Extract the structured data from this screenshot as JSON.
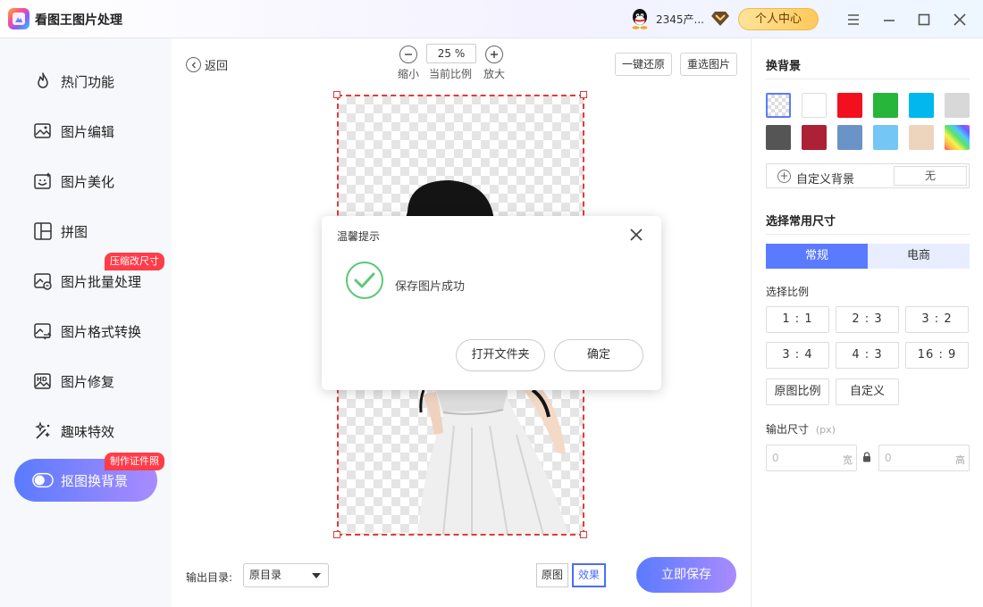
{
  "app": {
    "title": "看图王图片处理",
    "user_name": "2345产...",
    "personal_center": "个人中心"
  },
  "sidebar": {
    "items": [
      {
        "label": "热门功能",
        "icon": "flame-icon"
      },
      {
        "label": "图片编辑",
        "icon": "image-edit-icon"
      },
      {
        "label": "图片美化",
        "icon": "image-beautify-icon"
      },
      {
        "label": "拼图",
        "icon": "collage-icon"
      },
      {
        "label": "图片批量处理",
        "icon": "batch-image-icon",
        "badge": "压缩改尺寸"
      },
      {
        "label": "图片格式转换",
        "icon": "format-convert-icon"
      },
      {
        "label": "图片修复",
        "icon": "hd-image-icon"
      },
      {
        "label": "趣味特效",
        "icon": "magic-wand-icon"
      },
      {
        "label": "抠图换背景",
        "icon": "cutout-toggle-icon",
        "badge": "制作证件照",
        "active": true
      }
    ]
  },
  "toolbar": {
    "back": "返回",
    "zoom_value": "25 %",
    "zoom_out": "缩小",
    "current_ratio": "当前比例",
    "zoom_in": "放大",
    "reset": "一键还原",
    "reselect": "重选图片"
  },
  "footer": {
    "output_dir_label": "输出目录:",
    "output_dir_value": "原目录",
    "view_original": "原图",
    "view_effect": "效果",
    "save_now": "立即保存"
  },
  "right_panel": {
    "bg_title": "换背景",
    "swatch_colors": [
      "transparent",
      "#ffffff",
      "#f2101f",
      "#27b53a",
      "#00b7ee",
      "#d8d8d8",
      "#555555",
      "#ad2136",
      "#6a94c8",
      "#74c6f5",
      "#ecd4bd",
      "rainbow"
    ],
    "custom_bg_label": "自定义背景",
    "custom_bg_value": "无",
    "size_title": "选择常用尺寸",
    "tab_regular": "常规",
    "tab_ecommerce": "电商",
    "ratio_label": "选择比例",
    "ratios": [
      "1 : 1",
      "2 : 3",
      "3 : 2",
      "3 : 4",
      "4 : 3",
      "16 : 9"
    ],
    "original_ratio": "原图比例",
    "custom_ratio": "自定义",
    "output_size_label": "输出尺寸",
    "output_size_unit": "(px)",
    "width_value": "0",
    "width_unit": "宽",
    "height_value": "0",
    "height_unit": "高"
  },
  "modal": {
    "title": "温馨提示",
    "message": "保存图片成功",
    "open_folder": "打开文件夹",
    "confirm": "确定"
  },
  "colors": {
    "accent": "#5a7bff",
    "badge": "#ff3d4a",
    "selection": "#e23b3b",
    "success": "#5cc878"
  }
}
